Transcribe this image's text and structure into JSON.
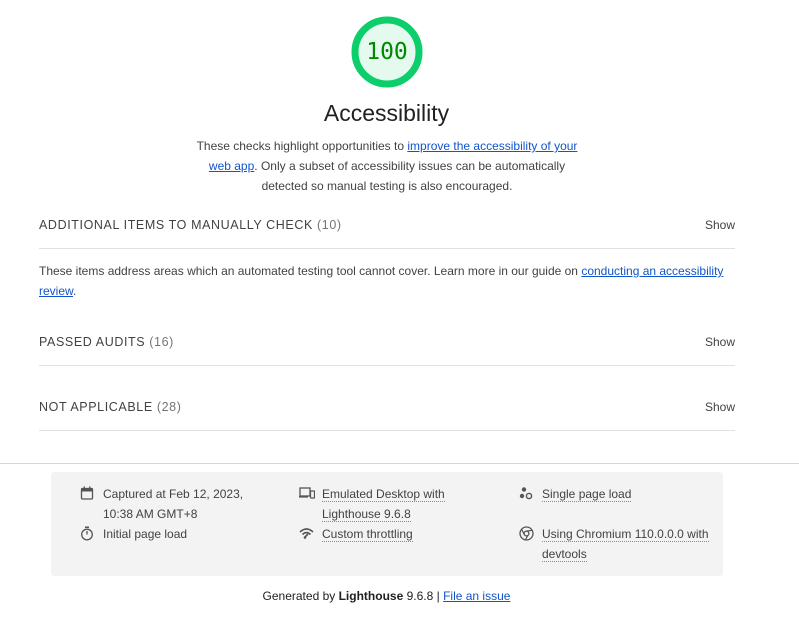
{
  "score": {
    "value": "100",
    "fraction": 1.0,
    "color": "#0cce6b"
  },
  "category": {
    "title": "Accessibility",
    "desc_before": "These checks highlight opportunities to ",
    "desc_link": "improve the accessibility of your web app",
    "desc_after": ". Only a subset of accessibility issues can be automatically detected so manual testing is also encouraged."
  },
  "groups": {
    "manual": {
      "title": "ADDITIONAL ITEMS TO MANUALLY CHECK",
      "count": "(10)",
      "toggle": "Show",
      "desc_before": "These items address areas which an automated testing tool cannot cover. Learn more in our guide on ",
      "desc_link": "conducting an accessibility review",
      "desc_after": "."
    },
    "passed": {
      "title": "PASSED AUDITS",
      "count": "(16)",
      "toggle": "Show"
    },
    "notapplicable": {
      "title": "NOT APPLICABLE",
      "count": "(28)",
      "toggle": "Show"
    }
  },
  "env": {
    "captured": "Captured at Feb 12, 2023, 10:38 AM GMT+8",
    "device": "Emulated Desktop with Lighthouse 9.6.8",
    "single_load": "Single page load",
    "initial_load": "Initial page load",
    "throttling": "Custom throttling",
    "browser": "Using Chromium 110.0.0.0 with devtools"
  },
  "footer": {
    "prefix": "Generated by ",
    "product": "Lighthouse",
    "version": " 9.6.8 | ",
    "issue_link": "File an issue"
  },
  "icons": {
    "captured": "calendar-icon",
    "device": "devices-icon",
    "single_load": "single-load-icon",
    "initial_load": "stopwatch-icon",
    "throttling": "network-throttling-icon",
    "browser": "chrome-icon"
  }
}
